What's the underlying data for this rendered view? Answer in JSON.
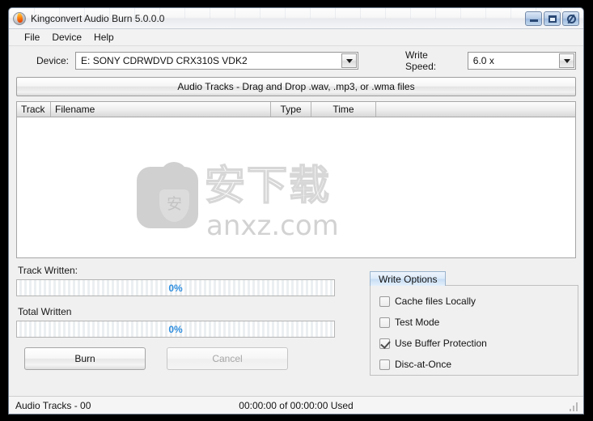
{
  "window": {
    "title": "Kingconvert Audio Burn 5.0.0.0",
    "icon": "flame-disc-icon",
    "controls": [
      {
        "name": "minimize",
        "glyph": "minimize-icon"
      },
      {
        "name": "maximize",
        "glyph": "maximize-icon"
      },
      {
        "name": "close",
        "glyph": "close-icon"
      }
    ]
  },
  "menubar": {
    "items": [
      {
        "label": "File"
      },
      {
        "label": "Device"
      },
      {
        "label": "Help"
      }
    ]
  },
  "device": {
    "label": "Device:",
    "value": "E: SONY CDRWDVD CRX310S VDK2",
    "dropdown_icon": "chevron-down-icon"
  },
  "write_speed": {
    "label": "Write Speed:",
    "value": "6.0 x",
    "dropdown_icon": "chevron-down-icon"
  },
  "dragdrop": {
    "label": "Audio Tracks - Drag and Drop .wav, .mp3, or .wma files"
  },
  "track_table": {
    "columns": [
      "Track",
      "Filename",
      "Type",
      "Time",
      ""
    ],
    "rows": []
  },
  "watermark": {
    "chinese": "安下载",
    "shield_char": "安",
    "url": "anxz.com"
  },
  "progress": {
    "track": {
      "label": "Track Written:",
      "value": "0%",
      "percent": 0
    },
    "total": {
      "label": "Total Written",
      "value": "0%",
      "percent": 0
    }
  },
  "actions": {
    "burn": {
      "label": "Burn",
      "enabled": true
    },
    "cancel": {
      "label": "Cancel",
      "enabled": false
    }
  },
  "write_options": {
    "title": "Write Options",
    "items": [
      {
        "label": "Cache files Locally",
        "checked": false
      },
      {
        "label": "Test Mode",
        "checked": false
      },
      {
        "label": "Use Buffer Protection",
        "checked": true
      },
      {
        "label": "Disc-at-Once",
        "checked": false
      }
    ]
  },
  "statusbar": {
    "left": "Audio Tracks - 00",
    "center": "00:00:00 of 00:00:00 Used",
    "grip_icon": "resize-grip-icon"
  },
  "colors": {
    "accent_blue": "#2f8fe0",
    "window_bg": "#f0f0f0",
    "flame_orange": "#ff8a10"
  }
}
